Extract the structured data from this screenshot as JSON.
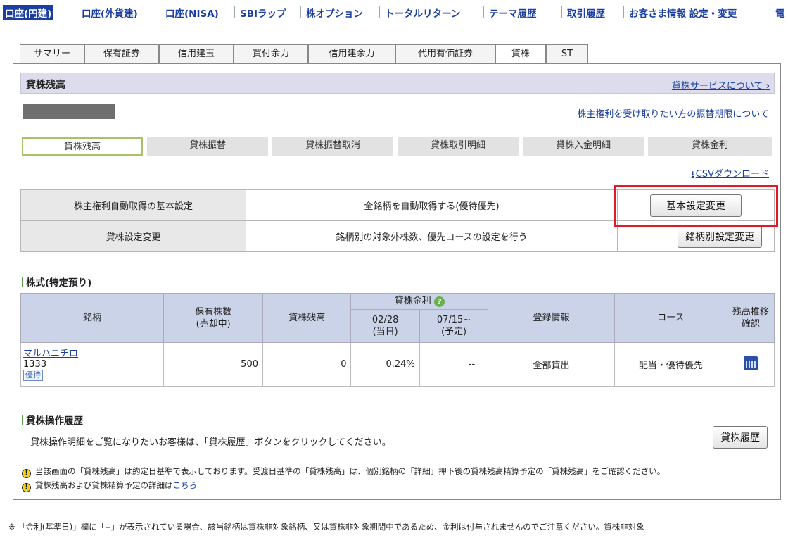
{
  "nav": {
    "items": [
      "口座(円建)",
      "口座(外貨建)",
      "口座(NISA)",
      "SBIラップ",
      "株オプション",
      "トータルリターン",
      "テーマ履歴",
      "取引履歴",
      "お客さま情報 設定・変更",
      "電"
    ]
  },
  "tabs": [
    "サマリー",
    "保有証券",
    "信用建玉",
    "買付余力",
    "信用建余力",
    "代用有価証券",
    "貸株",
    "ST"
  ],
  "header": {
    "title": "貸株残高",
    "service_link": "貸株サービスについて",
    "holder_link": "株主権利を受け取りたい方の振替期限について"
  },
  "subtabs": [
    "貸株残高",
    "貸株振替",
    "貸株振替取消",
    "貸株取引明細",
    "貸株入金明細",
    "貸株金利"
  ],
  "csv_link": "CSVダウンロード",
  "settings": {
    "row1": {
      "label": "株主権利自動取得の基本設定",
      "value": "全銘柄を自動取得する(優待優先)",
      "button": "基本設定変更"
    },
    "row2": {
      "label": "貸株設定変更",
      "value": "銘柄別の対象外株数、優先コースの設定を行う",
      "button": "銘柄別設定変更"
    }
  },
  "stocks": {
    "section_title": "株式(特定預り)",
    "headers": {
      "name": "銘柄",
      "qty_1": "保有株数",
      "qty_2": "(売却中)",
      "balance": "貸株残高",
      "rate": "貸株金利",
      "rate_today_1": "02/28",
      "rate_today_2": "(当日)",
      "rate_plan_1": "07/15~",
      "rate_plan_2": "(予定)",
      "reg": "登録情報",
      "course": "コース",
      "trend_1": "残高推移",
      "trend_2": "確認"
    },
    "row": {
      "name": "マルハニチロ",
      "code": "1333",
      "badge": "優待",
      "qty": "500",
      "balance": "0",
      "rate_today": "0.24%",
      "rate_plan": "--",
      "reg": "全部貸出",
      "course": "配当・優待優先"
    }
  },
  "history": {
    "section_title": "貸株操作履歴",
    "note": "貸株操作明細をご覧になりたいお客様は、「貸株履歴」ボタンをクリックしてください。",
    "button": "貸株履歴"
  },
  "notes": {
    "n1": "当該画面の「貸株残高」は約定日基準で表示しております。受渡日基準の「貸株残高」は、個別銘柄の「詳細」押下後の貸株残高精算予定の「貸株残高」をご確認ください。",
    "n2_text": "貸株残高および貸株精算予定の詳細は",
    "n2_link": "こちら"
  },
  "footer": "※  「金利(基準日)」欄に「--」が表示されている場合、該当銘柄は貸株非対象銘柄、又は貸株非対象期間中であるため、金利は付与されませんのでご注意ください。貸株非対象",
  "colors": {
    "link": "#1a3fa0",
    "highlight": "#e0192b",
    "table_header": "#cad3e8"
  }
}
